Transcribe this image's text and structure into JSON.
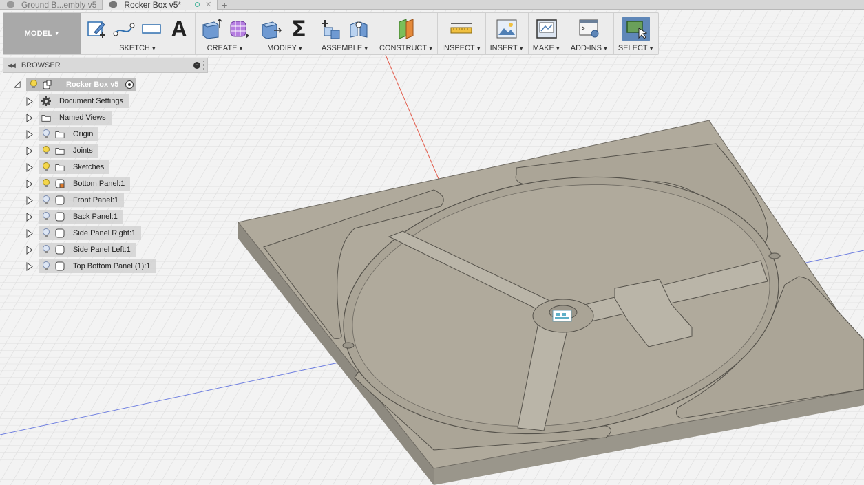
{
  "tabs": [
    {
      "label": "Ground B...embly v5",
      "active": false
    },
    {
      "label": "Rocker Box v5*",
      "active": true
    }
  ],
  "toolbar": {
    "workspace": "MODEL",
    "groups": [
      {
        "label": "SKETCH",
        "icons": [
          "sketch-icon",
          "spline-icon",
          "rectangle-icon",
          "text-icon"
        ]
      },
      {
        "label": "CREATE",
        "icons": [
          "extrude-icon",
          "form-icon"
        ]
      },
      {
        "label": "MODIFY",
        "icons": [
          "press-pull-icon",
          "parameters-icon"
        ]
      },
      {
        "label": "ASSEMBLE",
        "icons": [
          "new-component-icon",
          "joint-icon"
        ]
      },
      {
        "label": "CONSTRUCT",
        "icons": [
          "plane-icon"
        ]
      },
      {
        "label": "INSPECT",
        "icons": [
          "measure-icon"
        ]
      },
      {
        "label": "INSERT",
        "icons": [
          "insert-image-icon"
        ]
      },
      {
        "label": "MAKE",
        "icons": [
          "make-print-icon"
        ]
      },
      {
        "label": "ADD-INS",
        "icons": [
          "scripts-icon"
        ]
      },
      {
        "label": "SELECT",
        "icons": [
          "select-icon"
        ]
      }
    ],
    "sigma": "Σ",
    "text_glyph": "A"
  },
  "browser": {
    "title": "BROWSER",
    "root": "Rocker Box v5",
    "items": [
      {
        "label": "Document Settings",
        "icon": "gear-icon",
        "bulb": "none"
      },
      {
        "label": "Named Views",
        "icon": "folder-icon",
        "bulb": "none"
      },
      {
        "label": "Origin",
        "icon": "folder-icon",
        "bulb": "off"
      },
      {
        "label": "Joints",
        "icon": "folder-icon",
        "bulb": "on"
      },
      {
        "label": "Sketches",
        "icon": "folder-icon",
        "bulb": "on"
      },
      {
        "label": "Bottom Panel:1",
        "icon": "component-active-icon",
        "bulb": "on"
      },
      {
        "label": "Front Panel:1",
        "icon": "component-icon",
        "bulb": "off"
      },
      {
        "label": "Back Panel:1",
        "icon": "component-icon",
        "bulb": "off"
      },
      {
        "label": "Side Panel Right:1",
        "icon": "component-icon",
        "bulb": "off"
      },
      {
        "label": "Side Panel Left:1",
        "icon": "component-icon",
        "bulb": "off"
      },
      {
        "label": "Top Bottom Panel (1):1",
        "icon": "component-icon",
        "bulb": "off"
      }
    ]
  },
  "colors": {
    "model_top": "#b0aa9c",
    "model_side": "#8e8a80",
    "grid": "#dcdcdc",
    "axis_red": "#e25c4c",
    "axis_blue": "#6f7fe0",
    "select_blue": "#5f87b8"
  }
}
